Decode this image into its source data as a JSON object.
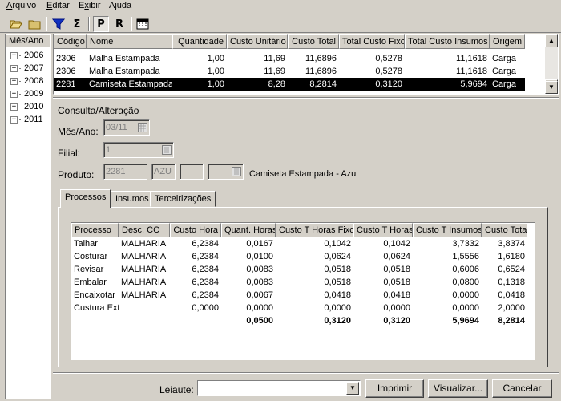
{
  "menu": {
    "items": [
      {
        "label": "Arquivo"
      },
      {
        "label": "Editar"
      },
      {
        "label": "Exibir"
      },
      {
        "label": "Ajuda"
      }
    ]
  },
  "toolbar": {
    "buttons": [
      {
        "icon": "open-folder-icon"
      },
      {
        "icon": "folder-icon"
      },
      {
        "icon": "filter-icon"
      },
      {
        "icon": "sum-icon",
        "label": "Σ"
      },
      {
        "icon": "p-icon",
        "label": "P"
      },
      {
        "icon": "r-icon",
        "label": "R"
      },
      {
        "icon": "calculator-icon"
      }
    ]
  },
  "tree": {
    "header": "Mês/Ano",
    "items": [
      "2006",
      "2007",
      "2008",
      "2009",
      "2010",
      "2011"
    ]
  },
  "grid1": {
    "columns": [
      "Código",
      "Nome",
      "Quantidade",
      "Custo Unitário",
      "Custo Total",
      "Total Custo Fixo",
      "Total Custo Insumos",
      "Origem"
    ],
    "rows": [
      [
        "2306",
        "Malha Estampada",
        "1,00",
        "11,69",
        "11,6896",
        "0,5278",
        "11,1618",
        "Carga"
      ],
      [
        "2306",
        "Malha Estampada",
        "1,00",
        "11,69",
        "11,6896",
        "0,5278",
        "11,1618",
        "Carga"
      ],
      [
        "2281",
        "Camiseta Estampada",
        "1,00",
        "8,28",
        "8,2814",
        "0,3120",
        "5,9694",
        "Carga"
      ]
    ],
    "selected_row": 2
  },
  "form": {
    "section_title": "Consulta/Alteração",
    "mes_ano_label": "Mês/Ano:",
    "mes_ano_value": "03/11",
    "filial_label": "Filial:",
    "filial_value": "1",
    "produto_label": "Produto:",
    "produto_code": "2281",
    "produto_color": "AZU",
    "produto_field3": "",
    "produto_field4": "",
    "produto_desc": "Camiseta Estampada  -  Azul"
  },
  "tabs": [
    {
      "label": "Processos",
      "active": true
    },
    {
      "label": "Insumos",
      "active": false
    },
    {
      "label": "Terceirizações",
      "active": false
    }
  ],
  "grid2": {
    "columns": [
      "Processo",
      "Desc. CC",
      "Custo Hora",
      "Quant. Horas",
      "Custo T Horas Fixo",
      "Custo T Horas",
      "Custo T Insumos",
      "Custo Total"
    ],
    "rows": [
      [
        "Talhar",
        "MALHARIA",
        "6,2384",
        "0,0167",
        "0,1042",
        "0,1042",
        "3,7332",
        "3,8374"
      ],
      [
        "Costurar",
        "MALHARIA",
        "6,2384",
        "0,0100",
        "0,0624",
        "0,0624",
        "1,5556",
        "1,6180"
      ],
      [
        "Revisar",
        "MALHARIA",
        "6,2384",
        "0,0083",
        "0,0518",
        "0,0518",
        "0,6006",
        "0,6524"
      ],
      [
        "Embalar",
        "MALHARIA",
        "6,2384",
        "0,0083",
        "0,0518",
        "0,0518",
        "0,0800",
        "0,1318"
      ],
      [
        "Encaixotar",
        "MALHARIA",
        "6,2384",
        "0,0067",
        "0,0418",
        "0,0418",
        "0,0000",
        "0,0418"
      ],
      [
        "Custura Ext",
        "",
        "0,0000",
        "0,0000",
        "0,0000",
        "0,0000",
        "0,0000",
        "2,0000"
      ]
    ],
    "totals": [
      "",
      "",
      "",
      "0,0500",
      "0,3120",
      "0,3120",
      "5,9694",
      "8,2814"
    ]
  },
  "bottom": {
    "leiaute_label": "Leiaute:",
    "leiaute_value": "",
    "print_label": "Imprimir",
    "preview_label": "Visualizar...",
    "cancel_label": "Cancelar"
  }
}
